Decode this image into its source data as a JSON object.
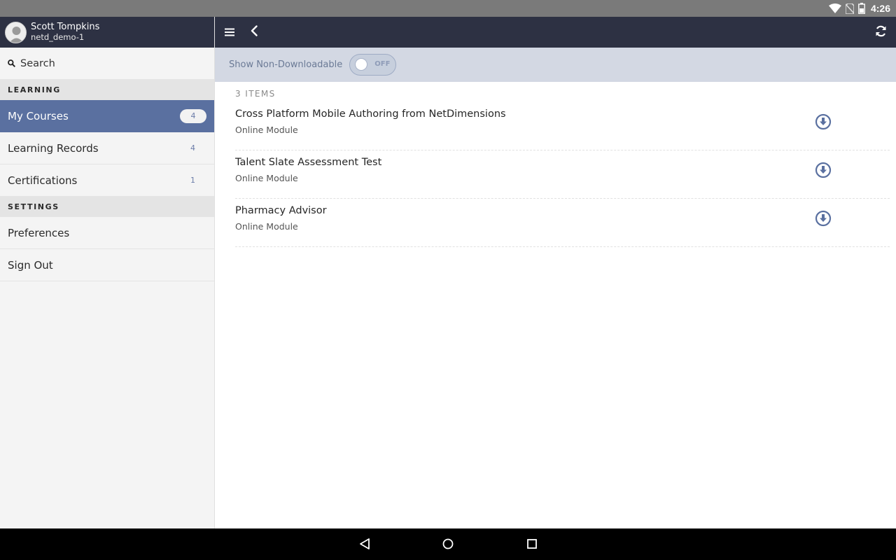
{
  "status_bar": {
    "time": "4:26"
  },
  "user": {
    "name": "Scott Tompkins",
    "username": "netd_demo-1"
  },
  "search": {
    "label": "Search"
  },
  "sidebar": {
    "learning_header": "LEARNING",
    "items": [
      {
        "label": "My Courses",
        "count": "4"
      },
      {
        "label": "Learning Records",
        "count": "4"
      },
      {
        "label": "Certifications",
        "count": "1"
      }
    ],
    "settings_header": "SETTINGS",
    "settings_items": [
      {
        "label": "Preferences"
      },
      {
        "label": "Sign Out"
      }
    ]
  },
  "filter": {
    "label": "Show Non-Downloadable",
    "toggle_state": "OFF"
  },
  "list": {
    "count_label": "3 ITEMS",
    "items": [
      {
        "title": "Cross Platform Mobile Authoring from NetDimensions",
        "subtitle": "Online Module"
      },
      {
        "title": "Talent Slate Assessment Test",
        "subtitle": "Online Module"
      },
      {
        "title": "Pharmacy Advisor",
        "subtitle": "Online Module"
      }
    ]
  },
  "colors": {
    "header_dark": "#2d3143",
    "active_nav": "#5a70a0",
    "filter_bg": "#d3d8e3",
    "accent_icon": "#5a70a0"
  },
  "icons": {
    "status": [
      "wifi-icon",
      "no-sim-icon",
      "battery-icon"
    ],
    "toolbar": [
      "menu-icon",
      "back-icon",
      "refresh-icon"
    ],
    "navigation": [
      "back-triangle-icon",
      "home-circle-icon",
      "recents-square-icon"
    ]
  }
}
